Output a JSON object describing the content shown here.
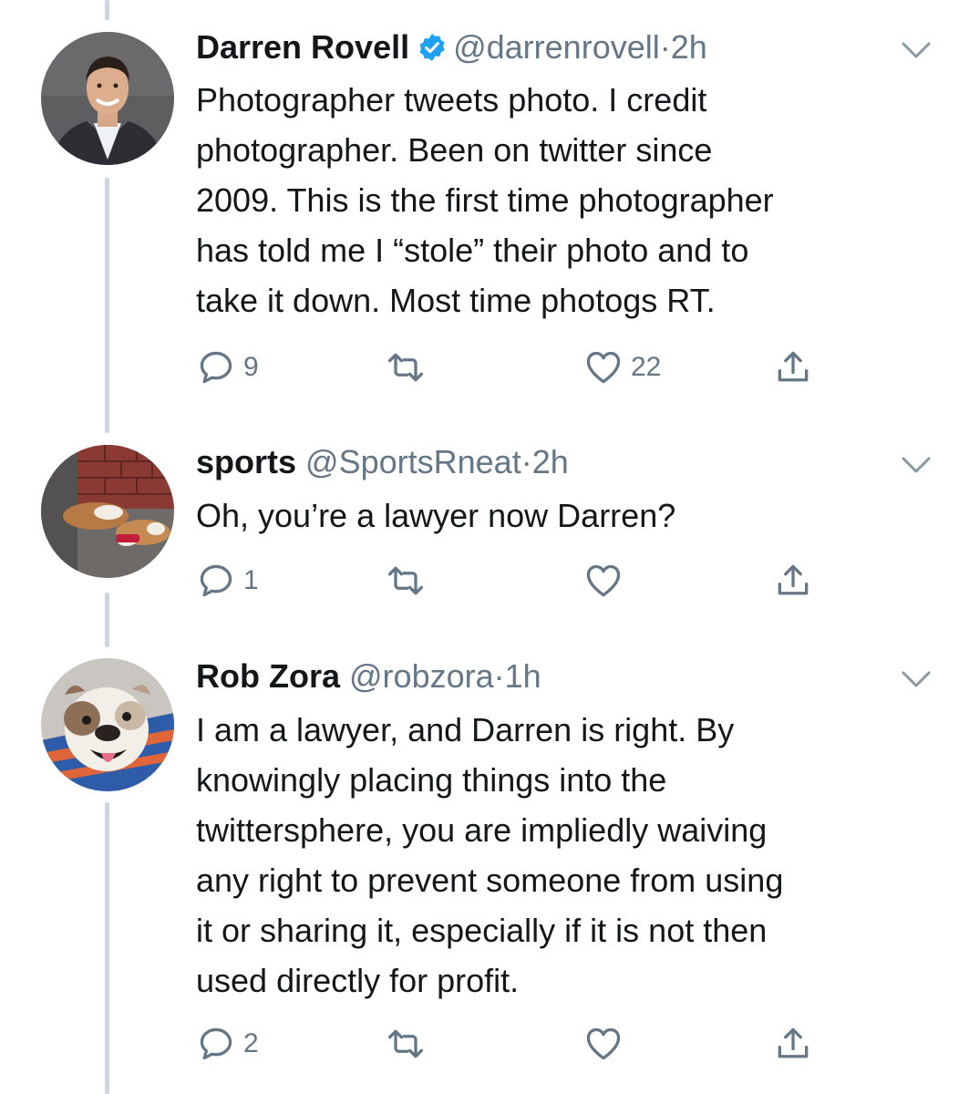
{
  "tweets": [
    {
      "name": "Darren Rovell",
      "verified": true,
      "handle": "@darrenrovell",
      "dot": "·",
      "time": "2h",
      "lines": [
        "Photographer tweets photo. I credit",
        "photographer. Been on twitter since",
        "2009. This is the first time photographer",
        "has told me I “stole” their photo and to",
        "take it down. Most time photogs RT."
      ],
      "reply_count": "9",
      "retweet_count": "",
      "like_count": "22"
    },
    {
      "name": "sports",
      "verified": false,
      "handle": "@SportsRneat",
      "dot": "·",
      "time": "2h",
      "lines": [
        "Oh, you’re a lawyer now Darren?"
      ],
      "reply_count": "1",
      "retweet_count": "",
      "like_count": ""
    },
    {
      "name": "Rob Zora",
      "verified": false,
      "handle": "@robzora",
      "dot": "·",
      "time": "1h",
      "lines": [
        "I am a lawyer, and Darren is right. By",
        "knowingly placing things into the",
        "twittersphere, you are impliedly waiving",
        "any right to prevent someone from using",
        "it or sharing it, especially if it is not then",
        "used directly for profit."
      ],
      "reply_count": "2",
      "retweet_count": "",
      "like_count": ""
    }
  ],
  "icons": {
    "reply": "reply-icon",
    "retweet": "retweet-icon",
    "like": "heart-icon",
    "share": "share-icon",
    "menu": "chevron-down-icon",
    "verified": "verified-badge-icon"
  },
  "colors": {
    "text": "#14171a",
    "secondary": "#657786",
    "verified": "#1da1f2",
    "thread_line": "#ccd6dd"
  }
}
